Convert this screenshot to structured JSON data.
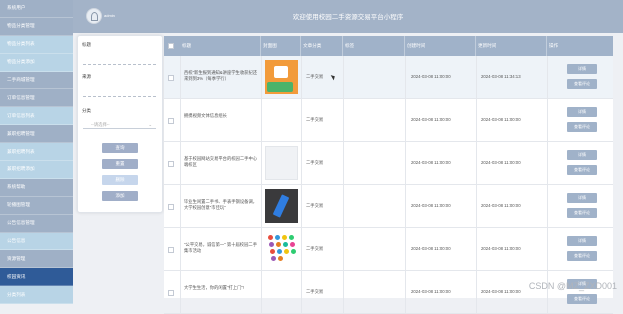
{
  "sidebar": {
    "items": [
      {
        "label": "系统用户",
        "style": "main"
      },
      {
        "label": "物品分类管理",
        "style": "main"
      },
      {
        "label": "物品分类列表",
        "style": "sub"
      },
      {
        "label": "物品分类添加",
        "style": "sub"
      },
      {
        "label": "二手商城管理",
        "style": "main"
      },
      {
        "label": "订单信息管理",
        "style": "main"
      },
      {
        "label": "订单信息列表",
        "style": "sub"
      },
      {
        "label": "兼职招聘管理",
        "style": "main"
      },
      {
        "label": "兼职招聘列表",
        "style": "sub"
      },
      {
        "label": "兼职招聘添加",
        "style": "sub"
      },
      {
        "label": "系统帮助",
        "style": "main"
      },
      {
        "label": "轮播图管理",
        "style": "main"
      },
      {
        "label": "公告信息管理",
        "style": "main"
      },
      {
        "label": "公告信息",
        "style": "sub"
      },
      {
        "label": "资源管理",
        "style": "main"
      },
      {
        "label": "校园资讯",
        "style": "active"
      },
      {
        "label": "分类列表",
        "style": "sub"
      }
    ]
  },
  "header": {
    "logo_text": "admin",
    "title": "欢迎使用校园二手资源交易平台小程序"
  },
  "filter": {
    "title_label": "标题",
    "source_label": "来源",
    "category_label": "分类",
    "category_placeholder": "--请选择--",
    "buttons": {
      "search": "查询",
      "reset": "重置",
      "delete": "删除",
      "add": "添加"
    }
  },
  "table": {
    "headers": [
      "标题",
      "封面图",
      "文章分类",
      "标签",
      "创建时间",
      "更新时间",
      "操作"
    ],
    "rows": [
      {
        "title": "西校“新生报到通知&讲座学生收获纪还来到到3%（每季学行）",
        "category": "二手交易",
        "created": "2024-03-08 11:00:00",
        "updated": "2024-03-08 11:34:13",
        "thumb": "orange"
      },
      {
        "title": "拥携视频文体信息组长",
        "category": "二手交易",
        "created": "2024-03-08 11:00:00",
        "updated": "2024-03-08 11:00:00",
        "thumb": "none"
      },
      {
        "title": "基于校园网站交易平台的校园二手中心端校区",
        "category": "二手交易",
        "created": "2024-03-08 11:00:00",
        "updated": "2024-03-08 11:00:00",
        "thumb": "empty"
      },
      {
        "title": "毕业生闲置二手书、手表手钢设备调，大学校园创意\"市佳玩\"",
        "category": "二手交易",
        "created": "2024-03-08 11:00:00",
        "updated": "2024-03-08 11:00:00",
        "thumb": "dark"
      },
      {
        "title": "\"公平交易，诚信第一\" 第十届校园二手集市活动",
        "category": "二手交易",
        "created": "2024-03-08 11:00:00",
        "updated": "2024-03-08 11:00:00",
        "thumb": "color"
      },
      {
        "title": "大学生生活，你的闲置\"打上门\"!",
        "category": "二手交易",
        "created": "2024-03-08 11:00:00",
        "updated": "2024-03-08 11:00:00",
        "thumb": "none"
      }
    ],
    "actions": {
      "detail": "详情",
      "edit": "查看评论"
    }
  },
  "watermark": "CSDN @MZ_ZXD001",
  "colors": {
    "sidebar": "#9fb0c6",
    "sidebar_active": "#2f5b98",
    "header": "#a3b3c8",
    "button": "#a0aec8"
  }
}
